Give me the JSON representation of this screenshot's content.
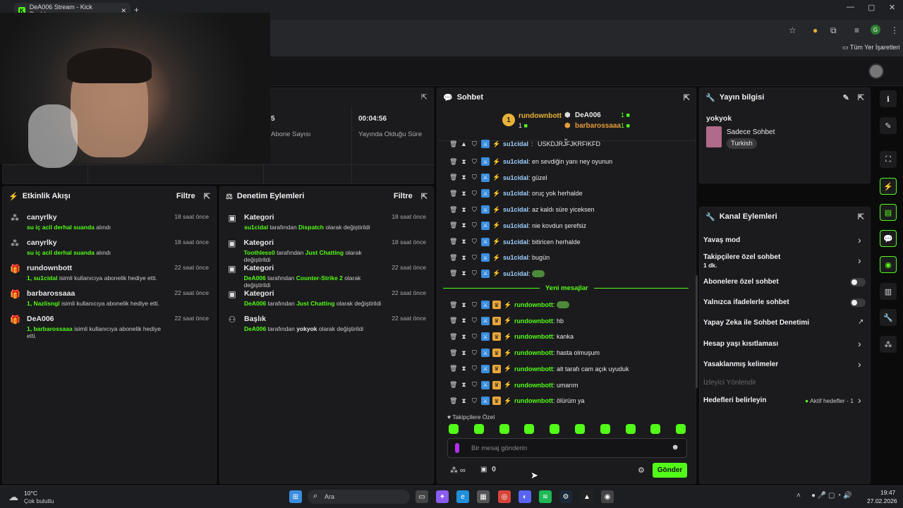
{
  "browser": {
    "tab_title": "DeA006 Stream - Kick Dashboa",
    "bookmarks": "Tüm Yer İşaretleri"
  },
  "stats": {
    "subs_value": "5",
    "subs_label": "Abone Sayısı",
    "uptime_value": "00:04:56",
    "uptime_label": "Yayında Olduğu Süre"
  },
  "activity": {
    "title": "Etkinlik Akışı",
    "filter": "Filtre",
    "items": [
      {
        "name": "canyrlky",
        "text": "su iç acil derhal suanda",
        "suffix": " alındı",
        "time": "18 saat önce"
      },
      {
        "name": "canyrlky",
        "text": "su iç acil derhal suanda",
        "suffix": " alındı",
        "time": "18 saat önce"
      },
      {
        "name": "rundownbott",
        "text": "1, su1cidal",
        "suffix": " isimli kullanıcıya abonelik hediye etti.",
        "time": "22 saat önce"
      },
      {
        "name": "barbarossaaa",
        "text": "1, Nazlisngl",
        "suffix": " isimli kullanıcıya abonelik hediye etti.",
        "time": "22 saat önce"
      },
      {
        "name": "DeA006",
        "text": "1, barbarossaaa",
        "suffix": " isimli kullanıcıya abonelik hediye etti.",
        "time": "22 saat önce"
      }
    ]
  },
  "moderation": {
    "title": "Denetim Eylemleri",
    "filter": "Filtre",
    "items": [
      {
        "title": "Kategori",
        "who": "su1cidal",
        "mid": " tarafından ",
        "what": "Dispatch",
        "end": " olarak değiştirildi",
        "time": "18 saat önce"
      },
      {
        "title": "Kategori",
        "who": "Toothless0",
        "mid": " tarafından ",
        "what": "Just Chatting",
        "end": " olarak değiştirildi",
        "time": "18 saat önce"
      },
      {
        "title": "Kategori",
        "who": "DeA006",
        "mid": " tarafından ",
        "what": "Counter-Strike 2",
        "end": " olarak değiştirildi",
        "time": "22 saat önce"
      },
      {
        "title": "Kategori",
        "who": "DeA006",
        "mid": " tarafından ",
        "what": "Just Chatting",
        "end": " olarak değiştirildi",
        "time": "22 saat önce"
      },
      {
        "title": "Başlık",
        "who": "DeA006",
        "mid": " tarafından ",
        "what": "yokyok",
        "end": " olarak değiştirildi",
        "time": "22 saat önce"
      }
    ]
  },
  "chat": {
    "title": "Sohbet",
    "top1": "rundownbott",
    "top1_count": "1",
    "top2": "DeA006",
    "top2_count": "1",
    "top3": "barbarossaaa",
    "top3_count": "1",
    "partial": "USKDJRJFJKRFIKFD",
    "msgs_old": [
      {
        "u": "su1cidal",
        "m": "en sevdiğin yanı ney oyunun"
      },
      {
        "u": "su1cidal",
        "m": "güzel"
      },
      {
        "u": "su1cidal",
        "m": "oruç yok herhalde"
      },
      {
        "u": "su1cidal",
        "m": "az kaldı süre yiceksen"
      },
      {
        "u": "su1cidal",
        "m": "nie kovdun şerefsiz"
      },
      {
        "u": "su1cidal",
        "m": "bitiricen herhalde"
      },
      {
        "u": "su1cidal",
        "m": "bugün"
      },
      {
        "u": "su1cidal",
        "m": ""
      }
    ],
    "new_label": "Yeni mesajlar",
    "msgs_new": [
      {
        "u": "rundownbott",
        "m": ""
      },
      {
        "u": "rundownbott",
        "m": "hb"
      },
      {
        "u": "rundownbott",
        "m": "kanka"
      },
      {
        "u": "rundownbott",
        "m": "hasta olmuşum"
      },
      {
        "u": "rundownbott",
        "m": "alt tarafı cam açık uyuduk"
      },
      {
        "u": "rundownbott",
        "m": "umarım"
      },
      {
        "u": "rundownbott",
        "m": "ölürüm ya"
      }
    ],
    "followers_label": "Takipçilere Özel",
    "placeholder": "Bir mesaj gönderin",
    "count": "0",
    "send": "Gönder"
  },
  "stream_info": {
    "title": "Yayın bilgisi",
    "stream_title": "yokyok",
    "category": "Sadece Sohbet",
    "language": "Turkish"
  },
  "channel_actions": {
    "title": "Kanal Eylemleri",
    "slow": "Yavaş mod",
    "followers": "Takipçilere özel sohbet",
    "followers_sub": "1 dk.",
    "subs": "Abonelere özel sohbet",
    "emotes": "Yalnızca ifadelerle sohbet",
    "ai": "Yapay Zeka ile Sohbet Denetimi",
    "age": "Hesap yaşı kısıtlaması",
    "banned": "Yasaklanmış kelimeler",
    "redirect": "İzleyici Yönlendir",
    "goals": "Hedefleri belirleyin",
    "goals_status": "Aktif hedefler - 1"
  },
  "taskbar": {
    "temp": "10°C",
    "weather": "Çok bulutlu",
    "search": "Ara",
    "time": "19:47",
    "date": "27.02.2026"
  }
}
